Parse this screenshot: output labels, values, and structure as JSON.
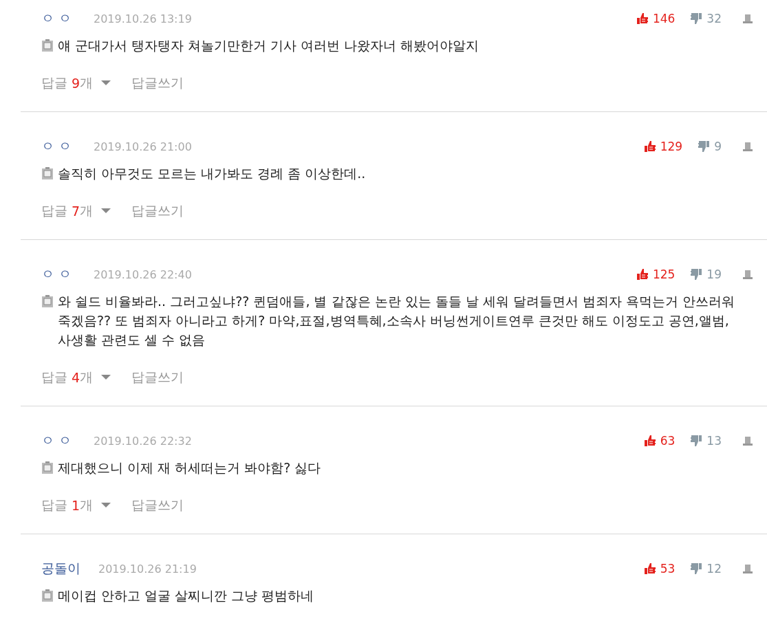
{
  "comments": [
    {
      "author": "ㅇㅇ",
      "date": "2019.10.26 13:19",
      "likes": "146",
      "dislikes": "32",
      "text": "얘 군대가서 탱자탱자 쳐놀기만한거 기사 여러번 나왔자너 해봤어야알지",
      "replies": {
        "label": "답글",
        "count": "9",
        "unit": "개"
      },
      "write": "답글쓰기"
    },
    {
      "author": "ㅇㅇ",
      "date": "2019.10.26 21:00",
      "likes": "129",
      "dislikes": "9",
      "text": "솔직히 아무것도 모르는 내가봐도 경례 좀 이상한데..",
      "replies": {
        "label": "답글",
        "count": "7",
        "unit": "개"
      },
      "write": "답글쓰기"
    },
    {
      "author": "ㅇㅇ",
      "date": "2019.10.26 22:40",
      "likes": "125",
      "dislikes": "19",
      "text": "와 쉴드 비율봐라.. 그러고싶냐?? 퀸덤애들, 별 같잖은 논란 있는 돌들 날 세워 달려들면서 범죄자 욕먹는거 안쓰러워 죽겠음?? 또 범죄자 아니라고 하게? 마약,표절,병역특혜,소속사 버닝썬게이트연루 큰것만 해도 이정도고 공연,앨범,사생활 관련도 셀 수 없음",
      "replies": {
        "label": "답글",
        "count": "4",
        "unit": "개"
      },
      "write": "답글쓰기"
    },
    {
      "author": "ㅇㅇ",
      "date": "2019.10.26 22:32",
      "likes": "63",
      "dislikes": "13",
      "text": "제대했으니 이제 재 허세떠는거 봐야함? 싫다",
      "replies": {
        "label": "답글",
        "count": "1",
        "unit": "개"
      },
      "write": "답글쓰기"
    },
    {
      "author": "공돌이",
      "date": "2019.10.26 21:19",
      "likes": "53",
      "dislikes": "12",
      "text": "메이컵 안하고 얼굴 살찌니깐 그냥 평범하네"
    }
  ]
}
